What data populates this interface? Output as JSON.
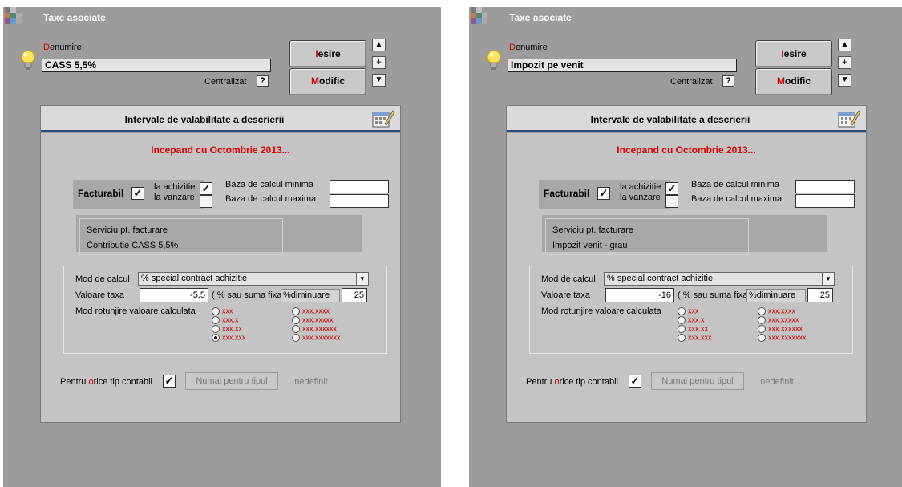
{
  "colors": {
    "window_bg": "#9c9c9c",
    "accent_red": "#e00000",
    "panel_header_border": "#2a4c7a"
  },
  "windows": [
    {
      "title": "Taxe asociate",
      "denumire_label_first": "D",
      "denumire_label_rest": "enumire",
      "denumire_value": "CASS 5,5%",
      "centralizat_label": "Centralizat",
      "help_button": "?",
      "iesire_hotkey": "I",
      "iesire_rest": "esire",
      "modific_hotkey": "M",
      "modific_rest": "odific",
      "nav_up_icon": "▲",
      "nav_plus": "+",
      "nav_down_icon": "▼",
      "panel_title": "Intervale de valabilitate a descrierii",
      "incepand": "Incepand cu Octombrie 2013...",
      "facturabil_label": "Facturabil",
      "facturabil_checked": "✓",
      "la_achizitie_label": "la achizitie",
      "la_achizitie_checked": "✓",
      "la_vanzare_label": "la vanzare",
      "la_vanzare_checked": "",
      "baza_min_label": "Baza de calcul minima",
      "baza_min_value": "",
      "baza_max_label": "Baza de calcul maxima",
      "baza_max_value": "",
      "serviciu_line1": "Serviciu pt. facturare",
      "serviciu_line2": "Contributie CASS 5,5%",
      "mod_calcul_label": "Mod de calcul",
      "mod_calcul_value": "% special contract achizitie",
      "valoare_taxa_label": "Valoare taxa",
      "valoare_taxa_value": "-5,5",
      "suma_label": "( % sau suma fixa)",
      "diminuare_label": "%diminuare",
      "diminuare_value": "25",
      "rotunjire_label": "Mod rotunjire valoare calculata",
      "radio_options": [
        "xxx",
        "xxx.x",
        "xxx.xx",
        "xxx.xxx",
        "xxx.xxxx",
        "xxx.xxxxx",
        "xxx.xxxxxx",
        "xxx.xxxxxxx"
      ],
      "radio_selected": "xxx.xxx",
      "pentru_prefix": "Pentru ",
      "pentru_hotkey": "o",
      "pentru_rest": "rice tip contabil",
      "pentru_checked": "✓",
      "numai_button": "Numai pentru tipul",
      "nedefinit": "... nedefinit ..."
    },
    {
      "title": "Taxe asociate",
      "denumire_label_first": "D",
      "denumire_label_rest": "enumire",
      "denumire_value": "Impozit pe venit",
      "centralizat_label": "Centralizat",
      "help_button": "?",
      "iesire_hotkey": "I",
      "iesire_rest": "esire",
      "modific_hotkey": "M",
      "modific_rest": "odific",
      "nav_up_icon": "▲",
      "nav_plus": "+",
      "nav_down_icon": "▼",
      "panel_title": "Intervale de valabilitate a descrierii",
      "incepand": "Incepand cu Octombrie 2013...",
      "facturabil_label": "Facturabil",
      "facturabil_checked": "✓",
      "la_achizitie_label": "la achizitie",
      "la_achizitie_checked": "✓",
      "la_vanzare_label": "la vanzare",
      "la_vanzare_checked": "",
      "baza_min_label": "Baza de calcul minima",
      "baza_min_value": "",
      "baza_max_label": "Baza de calcul maxima",
      "baza_max_value": "",
      "serviciu_line1": "Serviciu pt. facturare",
      "serviciu_line2": "Impozit venit - grau",
      "mod_calcul_label": "Mod de calcul",
      "mod_calcul_value": "% special contract achizitie",
      "valoare_taxa_label": "Valoare taxa",
      "valoare_taxa_value": "-16",
      "suma_label": "( % sau suma fixa)",
      "diminuare_label": "%diminuare",
      "diminuare_value": "25",
      "rotunjire_label": "Mod rotunjire valoare calculata",
      "radio_options": [
        "xxx",
        "xxx.x",
        "xxx.xx",
        "xxx.xxx",
        "xxx.xxxx",
        "xxx.xxxxx",
        "xxx.xxxxxx",
        "xxx.xxxxxxx"
      ],
      "radio_selected": "",
      "pentru_prefix": "Pentru ",
      "pentru_hotkey": "o",
      "pentru_rest": "rice tip contabil",
      "pentru_checked": "✓",
      "numai_button": "Numai pentru tipul",
      "nedefinit": "... nedefinit ..."
    }
  ]
}
